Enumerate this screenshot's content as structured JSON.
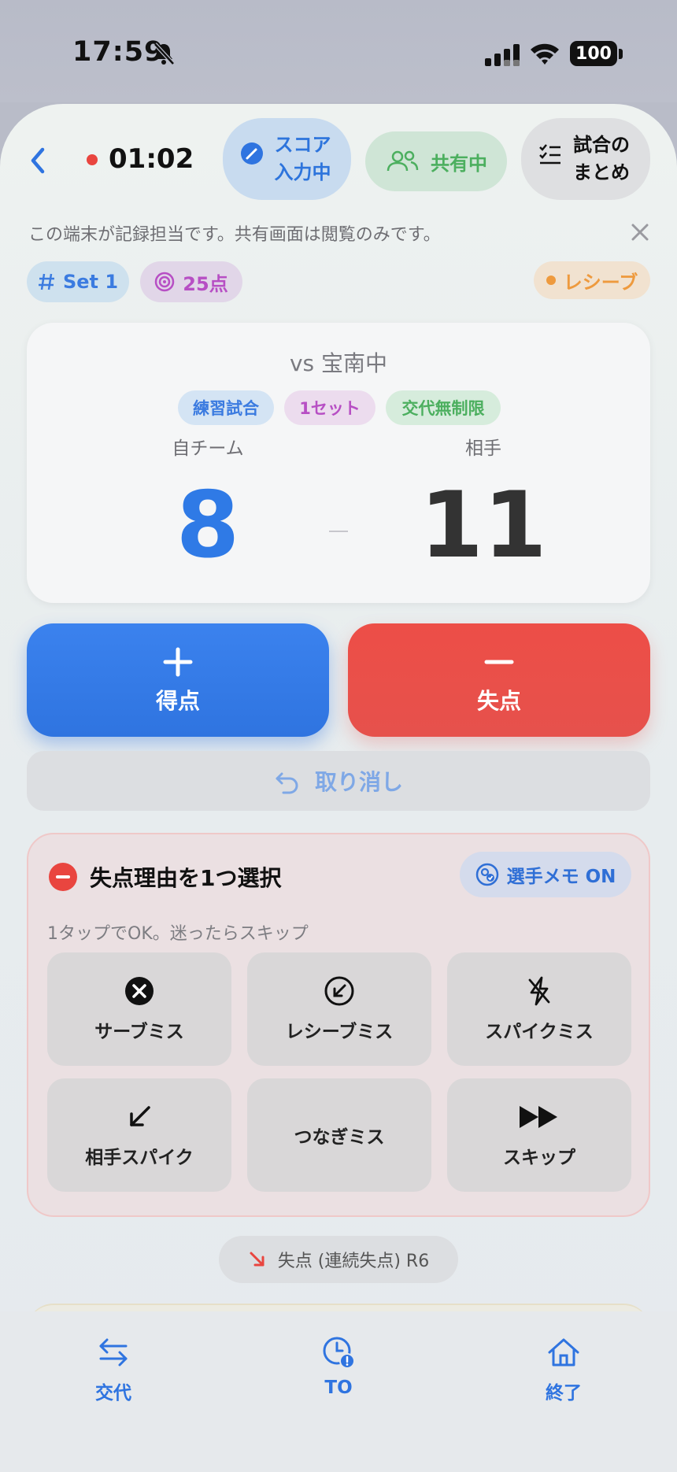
{
  "status_bar": {
    "time": "17:59",
    "battery": "100"
  },
  "header": {
    "timer": "01:02",
    "score_input_line1": "スコア",
    "score_input_line2": "入力中",
    "sharing": "共有中",
    "summary_line1": "試合の",
    "summary_line2": "まとめ"
  },
  "info_banner": {
    "text": "この端末が記録担当です。共有画面は閲覧のみです。"
  },
  "tags": {
    "set": "Set 1",
    "points": "25点",
    "phase": "レシーブ"
  },
  "match": {
    "opponent": "vs 宝南中",
    "badges": [
      "練習試合",
      "1セット",
      "交代無制限"
    ],
    "home_label": "自チーム",
    "away_label": "相手",
    "home_score": "8",
    "away_score": "11"
  },
  "actions": {
    "score_label": "得点",
    "lose_label": "失点",
    "undo_label": "取り消し"
  },
  "reason_panel": {
    "title": "失点理由を1つ選択",
    "memo": "選手メモ ON",
    "subtitle": "1タップでOK。迷ったらスキップ",
    "options": [
      "サーブミス",
      "レシーブミス",
      "スパイクミス",
      "相手スパイク",
      "つなぎミス",
      "スキップ"
    ]
  },
  "streak": {
    "text": "失点 (連続失点) R6"
  },
  "tabbar": {
    "swap": "交代",
    "timeout": "TO",
    "end": "終了"
  },
  "colors": {
    "accent": "#2f74e0",
    "danger": "#e9453f",
    "success": "#4caf5f",
    "purple": "#b74fc4",
    "orange": "#ee9a3e"
  }
}
